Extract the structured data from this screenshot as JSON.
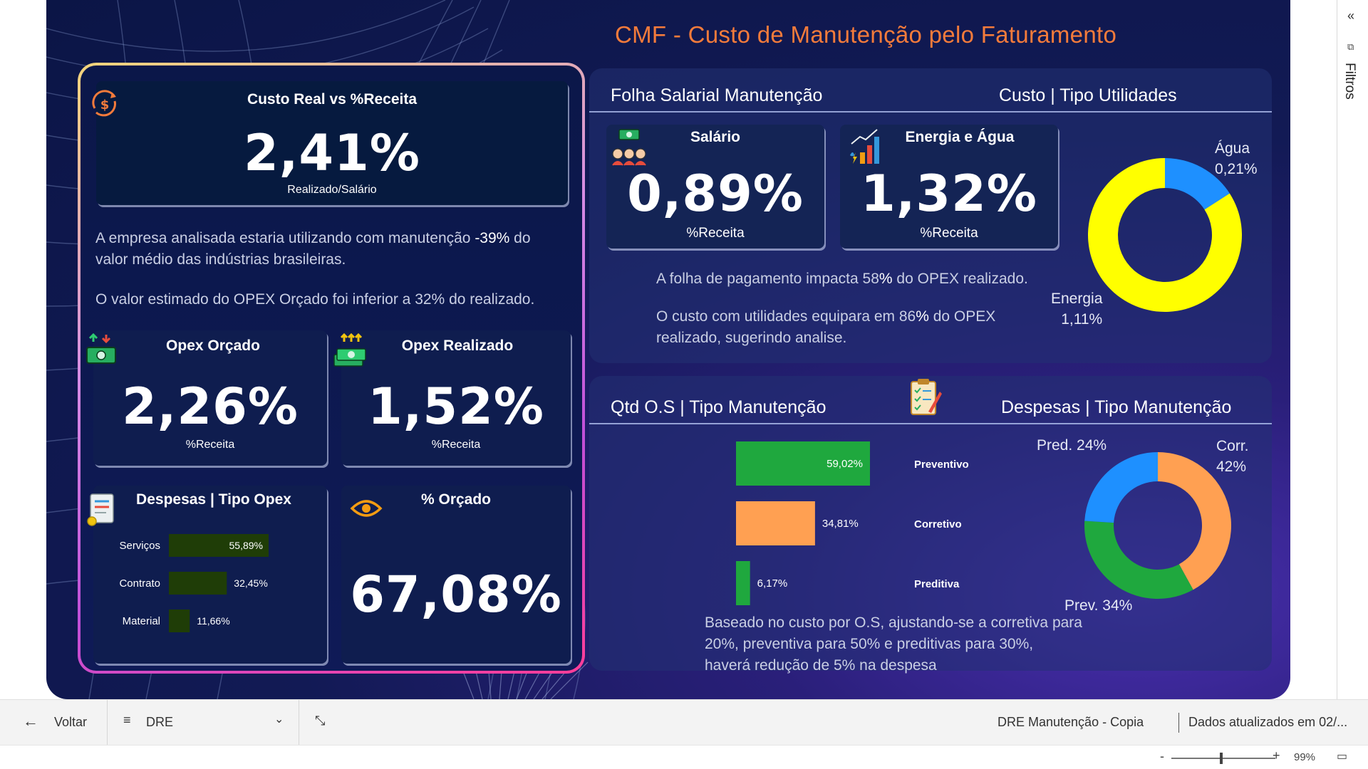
{
  "report": {
    "title": "CMF - Custo de Manutenção pelo Faturamento"
  },
  "left": {
    "custo_real": {
      "title": "Custo Real vs %Receita",
      "value": "2,41%",
      "subtitle": "Realizado/Salário"
    },
    "text1_pre": "A empresa analisada estaria utilizando com manutenção ",
    "text1_strong": "-39%",
    "text1_post": " do valor médio das indústrias brasileiras.",
    "text2": "O valor estimado do OPEX Orçado foi inferior a 32% do realizado.",
    "opex_orcado": {
      "title": "Opex Orçado",
      "value": "2,26%",
      "subtitle": "%Receita"
    },
    "opex_realizado": {
      "title": "Opex Realizado",
      "value": "1,52%",
      "subtitle": "%Receita"
    },
    "despesas_opex": {
      "title": "Despesas | Tipo Opex",
      "chart_data": {
        "type": "bar",
        "orientation": "horizontal",
        "categories": [
          "Serviços",
          "Contrato",
          "Material"
        ],
        "values": [
          55.89,
          32.45,
          11.66
        ],
        "labels": [
          "55,89%",
          "32,45%",
          "11,66%"
        ],
        "color": "#1f3d07"
      }
    },
    "orcado": {
      "title": "% Orçado",
      "value": "67,08%"
    }
  },
  "folha": {
    "title": "Folha Salarial Manutenção",
    "salario": {
      "title": "Salário",
      "value": "0,89%",
      "subtitle": "%Receita"
    },
    "energia": {
      "title": "Energia e Água",
      "value": "1,32%",
      "subtitle": "%Receita"
    },
    "text1_pre": "A folha de pagamento impacta 58",
    "text1_strong": "%",
    "text1_post": " do OPEX realizado.",
    "text2_pre": "O custo com utilidades equipara em 86",
    "text2_strong": "%",
    "text2_post": " do OPEX realizado, sugerindo analise."
  },
  "utilidades": {
    "title": "Custo | Tipo Utilidades",
    "chart_data": {
      "type": "pie",
      "donut": true,
      "series": [
        {
          "name": "Água",
          "value": 0.21,
          "label": "0,21%",
          "color": "#1e90ff"
        },
        {
          "name": "Energia",
          "value": 1.11,
          "label": "1,11%",
          "color": "#ffff00"
        }
      ]
    },
    "agua_name": "Água",
    "agua_value": "0,21%",
    "energia_name": "Energia",
    "energia_value": "1,11%"
  },
  "qtd_os": {
    "title": "Qtd O.S | Tipo Manutenção",
    "chart_data": {
      "type": "bar",
      "orientation": "horizontal",
      "categories": [
        "Preventivo",
        "Corretivo",
        "Preditiva"
      ],
      "values": [
        59.02,
        34.81,
        6.17
      ],
      "labels": [
        "59,02%",
        "34,81%",
        "6,17%"
      ],
      "colors": [
        "#1fa83e",
        "#ffa052",
        "#1fa83e"
      ]
    },
    "note": "Baseado no custo por O.S, ajustando-se a corretiva para 20%, preventiva para 50% e preditivas para 30%, haverá redução de 5% na despesa"
  },
  "despesas_manut": {
    "title": "Despesas | Tipo Manutenção",
    "chart_data": {
      "type": "pie",
      "donut": true,
      "series": [
        {
          "name": "Corr.",
          "value": 42,
          "color": "#ffa052"
        },
        {
          "name": "Prev.",
          "value": 34,
          "color": "#1fa83e"
        },
        {
          "name": "Pred.",
          "value": 24,
          "color": "#1e90ff"
        }
      ]
    },
    "pred_label": "Pred. 24%",
    "corr_name": "Corr.",
    "corr_value": "42%",
    "prev_label": "Prev. 34%"
  },
  "side": {
    "filters_label": "Filtros",
    "collapse_icon": "«"
  },
  "bottom": {
    "back_label": "Voltar",
    "page_selector": "DRE",
    "report_name": "DRE Manutenção - Copia",
    "updated": "Dados atualizados em 02/..."
  },
  "status": {
    "zoom": "99%",
    "zoom_value": 0.99
  }
}
